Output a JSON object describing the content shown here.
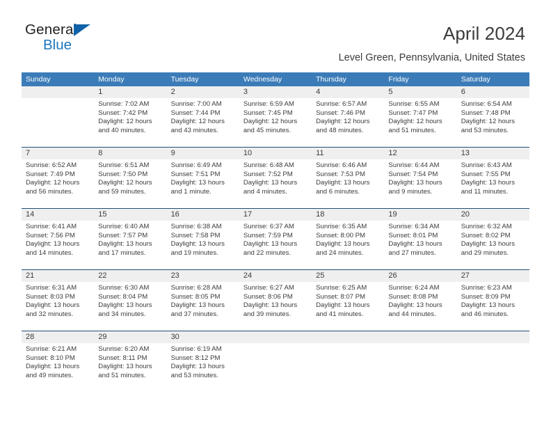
{
  "brand": {
    "name_part1": "General",
    "name_part2": "Blue",
    "triangle_color": "#1062a8",
    "blue_color": "#1b75bb"
  },
  "header": {
    "title": "April 2024",
    "subtitle": "Level Green, Pennsylvania, United States",
    "header_bg": "#3b7cb8",
    "row_divider": "#1f4e79",
    "daynum_bg": "#efefef"
  },
  "weekdays": [
    "Sunday",
    "Monday",
    "Tuesday",
    "Wednesday",
    "Thursday",
    "Friday",
    "Saturday"
  ],
  "weeks": [
    [
      {
        "day": "",
        "sunrise": "",
        "sunset": "",
        "daylight1": "",
        "daylight2": ""
      },
      {
        "day": "1",
        "sunrise": "Sunrise: 7:02 AM",
        "sunset": "Sunset: 7:42 PM",
        "daylight1": "Daylight: 12 hours",
        "daylight2": "and 40 minutes."
      },
      {
        "day": "2",
        "sunrise": "Sunrise: 7:00 AM",
        "sunset": "Sunset: 7:44 PM",
        "daylight1": "Daylight: 12 hours",
        "daylight2": "and 43 minutes."
      },
      {
        "day": "3",
        "sunrise": "Sunrise: 6:59 AM",
        "sunset": "Sunset: 7:45 PM",
        "daylight1": "Daylight: 12 hours",
        "daylight2": "and 45 minutes."
      },
      {
        "day": "4",
        "sunrise": "Sunrise: 6:57 AM",
        "sunset": "Sunset: 7:46 PM",
        "daylight1": "Daylight: 12 hours",
        "daylight2": "and 48 minutes."
      },
      {
        "day": "5",
        "sunrise": "Sunrise: 6:55 AM",
        "sunset": "Sunset: 7:47 PM",
        "daylight1": "Daylight: 12 hours",
        "daylight2": "and 51 minutes."
      },
      {
        "day": "6",
        "sunrise": "Sunrise: 6:54 AM",
        "sunset": "Sunset: 7:48 PM",
        "daylight1": "Daylight: 12 hours",
        "daylight2": "and 53 minutes."
      }
    ],
    [
      {
        "day": "7",
        "sunrise": "Sunrise: 6:52 AM",
        "sunset": "Sunset: 7:49 PM",
        "daylight1": "Daylight: 12 hours",
        "daylight2": "and 56 minutes."
      },
      {
        "day": "8",
        "sunrise": "Sunrise: 6:51 AM",
        "sunset": "Sunset: 7:50 PM",
        "daylight1": "Daylight: 12 hours",
        "daylight2": "and 59 minutes."
      },
      {
        "day": "9",
        "sunrise": "Sunrise: 6:49 AM",
        "sunset": "Sunset: 7:51 PM",
        "daylight1": "Daylight: 13 hours",
        "daylight2": "and 1 minute."
      },
      {
        "day": "10",
        "sunrise": "Sunrise: 6:48 AM",
        "sunset": "Sunset: 7:52 PM",
        "daylight1": "Daylight: 13 hours",
        "daylight2": "and 4 minutes."
      },
      {
        "day": "11",
        "sunrise": "Sunrise: 6:46 AM",
        "sunset": "Sunset: 7:53 PM",
        "daylight1": "Daylight: 13 hours",
        "daylight2": "and 6 minutes."
      },
      {
        "day": "12",
        "sunrise": "Sunrise: 6:44 AM",
        "sunset": "Sunset: 7:54 PM",
        "daylight1": "Daylight: 13 hours",
        "daylight2": "and 9 minutes."
      },
      {
        "day": "13",
        "sunrise": "Sunrise: 6:43 AM",
        "sunset": "Sunset: 7:55 PM",
        "daylight1": "Daylight: 13 hours",
        "daylight2": "and 11 minutes."
      }
    ],
    [
      {
        "day": "14",
        "sunrise": "Sunrise: 6:41 AM",
        "sunset": "Sunset: 7:56 PM",
        "daylight1": "Daylight: 13 hours",
        "daylight2": "and 14 minutes."
      },
      {
        "day": "15",
        "sunrise": "Sunrise: 6:40 AM",
        "sunset": "Sunset: 7:57 PM",
        "daylight1": "Daylight: 13 hours",
        "daylight2": "and 17 minutes."
      },
      {
        "day": "16",
        "sunrise": "Sunrise: 6:38 AM",
        "sunset": "Sunset: 7:58 PM",
        "daylight1": "Daylight: 13 hours",
        "daylight2": "and 19 minutes."
      },
      {
        "day": "17",
        "sunrise": "Sunrise: 6:37 AM",
        "sunset": "Sunset: 7:59 PM",
        "daylight1": "Daylight: 13 hours",
        "daylight2": "and 22 minutes."
      },
      {
        "day": "18",
        "sunrise": "Sunrise: 6:35 AM",
        "sunset": "Sunset: 8:00 PM",
        "daylight1": "Daylight: 13 hours",
        "daylight2": "and 24 minutes."
      },
      {
        "day": "19",
        "sunrise": "Sunrise: 6:34 AM",
        "sunset": "Sunset: 8:01 PM",
        "daylight1": "Daylight: 13 hours",
        "daylight2": "and 27 minutes."
      },
      {
        "day": "20",
        "sunrise": "Sunrise: 6:32 AM",
        "sunset": "Sunset: 8:02 PM",
        "daylight1": "Daylight: 13 hours",
        "daylight2": "and 29 minutes."
      }
    ],
    [
      {
        "day": "21",
        "sunrise": "Sunrise: 6:31 AM",
        "sunset": "Sunset: 8:03 PM",
        "daylight1": "Daylight: 13 hours",
        "daylight2": "and 32 minutes."
      },
      {
        "day": "22",
        "sunrise": "Sunrise: 6:30 AM",
        "sunset": "Sunset: 8:04 PM",
        "daylight1": "Daylight: 13 hours",
        "daylight2": "and 34 minutes."
      },
      {
        "day": "23",
        "sunrise": "Sunrise: 6:28 AM",
        "sunset": "Sunset: 8:05 PM",
        "daylight1": "Daylight: 13 hours",
        "daylight2": "and 37 minutes."
      },
      {
        "day": "24",
        "sunrise": "Sunrise: 6:27 AM",
        "sunset": "Sunset: 8:06 PM",
        "daylight1": "Daylight: 13 hours",
        "daylight2": "and 39 minutes."
      },
      {
        "day": "25",
        "sunrise": "Sunrise: 6:25 AM",
        "sunset": "Sunset: 8:07 PM",
        "daylight1": "Daylight: 13 hours",
        "daylight2": "and 41 minutes."
      },
      {
        "day": "26",
        "sunrise": "Sunrise: 6:24 AM",
        "sunset": "Sunset: 8:08 PM",
        "daylight1": "Daylight: 13 hours",
        "daylight2": "and 44 minutes."
      },
      {
        "day": "27",
        "sunrise": "Sunrise: 6:23 AM",
        "sunset": "Sunset: 8:09 PM",
        "daylight1": "Daylight: 13 hours",
        "daylight2": "and 46 minutes."
      }
    ],
    [
      {
        "day": "28",
        "sunrise": "Sunrise: 6:21 AM",
        "sunset": "Sunset: 8:10 PM",
        "daylight1": "Daylight: 13 hours",
        "daylight2": "and 49 minutes."
      },
      {
        "day": "29",
        "sunrise": "Sunrise: 6:20 AM",
        "sunset": "Sunset: 8:11 PM",
        "daylight1": "Daylight: 13 hours",
        "daylight2": "and 51 minutes."
      },
      {
        "day": "30",
        "sunrise": "Sunrise: 6:19 AM",
        "sunset": "Sunset: 8:12 PM",
        "daylight1": "Daylight: 13 hours",
        "daylight2": "and 53 minutes."
      },
      {
        "day": "",
        "sunrise": "",
        "sunset": "",
        "daylight1": "",
        "daylight2": ""
      },
      {
        "day": "",
        "sunrise": "",
        "sunset": "",
        "daylight1": "",
        "daylight2": ""
      },
      {
        "day": "",
        "sunrise": "",
        "sunset": "",
        "daylight1": "",
        "daylight2": ""
      },
      {
        "day": "",
        "sunrise": "",
        "sunset": "",
        "daylight1": "",
        "daylight2": ""
      }
    ]
  ]
}
